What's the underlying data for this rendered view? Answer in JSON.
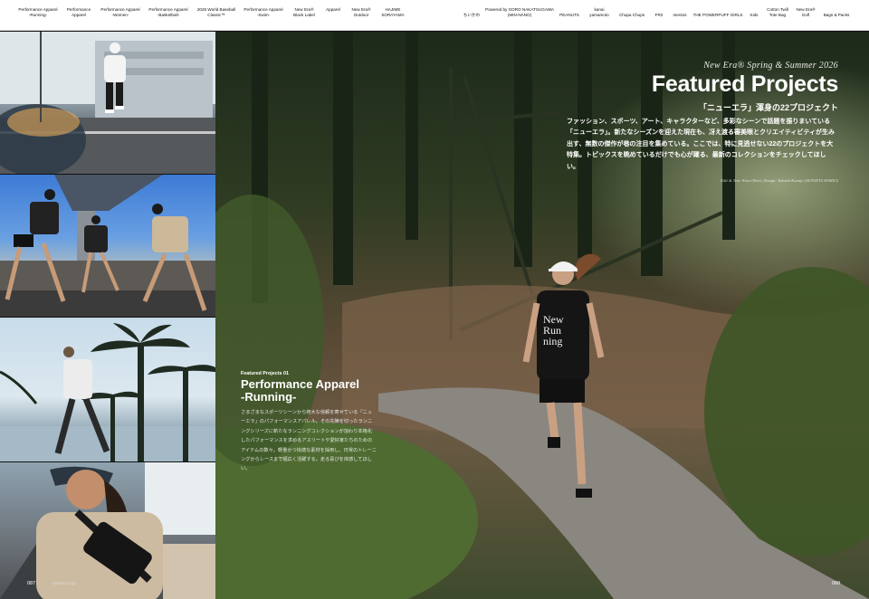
{
  "nav": {
    "items": [
      {
        "label": "Performance Apparel\n-Running-"
      },
      {
        "label": "Performance\nApparel"
      },
      {
        "label": "Performance Apparel\n-Women-"
      },
      {
        "label": "Performance Apparel\n-Basketball-"
      },
      {
        "label": "2026 World Baseball\nClassic™"
      },
      {
        "label": "Performance Apparel\n-Swim-"
      },
      {
        "label": "New Era®\nBlack Label"
      },
      {
        "label": "Apparel"
      },
      {
        "label": "New Era®\nOutdoor"
      },
      {
        "label": "HAJIME\nSORAYAMA"
      },
      {
        "label": "ちいかわ"
      },
      {
        "label": "Powered by GORO NAKATSUGAWA\n(MIN-NANO)"
      },
      {
        "label": "PEANUTS"
      },
      {
        "label": "kanai\nyamamoto"
      },
      {
        "label": "Chupa Chups"
      },
      {
        "label": "FR2"
      },
      {
        "label": "mentos"
      },
      {
        "label": "THE POWERPUFF GIRLS"
      },
      {
        "label": "Kids"
      },
      {
        "label": "Cotton Twill\nTote Bag"
      },
      {
        "label": "New Era®\nGolf"
      },
      {
        "label": "Bags & Packs"
      }
    ]
  },
  "hero": {
    "kicker": "New Era® Spring & Summer 2026",
    "title": "Featured Projects",
    "subtitle": "「ニューエラ」渾身の22プロジェクト",
    "intro": "ファッション、スポーツ、アート、キャラクターなど、多彩なシーンで話題を振りまいている「ニューエラ」。新たなシーズンを迎えた現在も、冴え渡る審美眼とクリエイティビティが生み出す、無数の傑作が巷の注目を集めている。ここでは、特に見逃せない22のプロジェクトを大特集。トピックスを眺めているだけでも心が躍る、最新のコレクションをチェックしてほしい。",
    "credit": "Edit & Text: Kota Ohori, Design: Takashi Kamijo (SUNSETS MARIO)",
    "shirt_text": "New\nRun\nning"
  },
  "feature": {
    "label": "Featured Projects 01",
    "title_line1": "Performance Apparel",
    "title_line2": "-Running-",
    "text": "さまざまなスポーツシーンから熱大な信頼を寄せている「ニューエラ」のパフォーマンスアパレル。その先陣を切ったランニングシリーズに新たなランニングコレクションが加わり本格化したパフォーマンスを求めるアスリートや愛好家たちのためのアイテムの数々。軽量かつ快適な素材を採用し、日常のトレーニングからレースまで幅広く活躍する。走る喜びを体感してほしい。"
  },
  "pages": {
    "left": "087",
    "left_tag": "newera.co.jp",
    "right": "088"
  },
  "colors": {
    "nav_bg": "#ffffff",
    "text_light": "#ffffff",
    "cap_white": "#f2f2f2",
    "shirt_black": "#151515"
  }
}
